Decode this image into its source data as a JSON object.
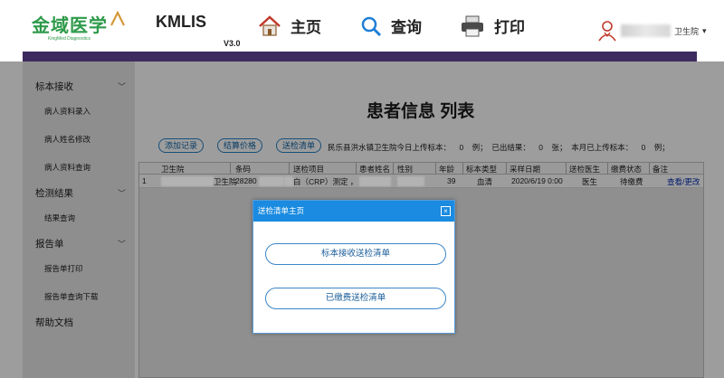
{
  "header": {
    "logo_cn": "金域医学",
    "logo_en": "KingMed Diagnostics",
    "app_name": "KMLIS",
    "version": "V3.0",
    "nav": [
      {
        "label": "主页",
        "icon": "home-icon"
      },
      {
        "label": "查询",
        "icon": "search-icon"
      },
      {
        "label": "打印",
        "icon": "printer-icon"
      }
    ],
    "user_suffix": "卫生院",
    "user_caret": "▾"
  },
  "colors": {
    "brand_green": "#2e9a4a",
    "header_bar": "#3d2a5e",
    "modal_title_bg": "#1a8be0",
    "modal_button_border": "#3b86c8"
  },
  "sidebar": {
    "groups": [
      {
        "label": "标本接收",
        "items": [
          "病人资料录入",
          "病人姓名修改",
          "病人资料查询"
        ]
      },
      {
        "label": "检测结果",
        "items": [
          "结果查询"
        ]
      },
      {
        "label": "报告单",
        "items": [
          "报告单打印",
          "报告单查询下载"
        ]
      },
      {
        "label": "帮助文档",
        "items": []
      }
    ]
  },
  "main": {
    "title": "患者信息 列表",
    "toolbar": [
      "添加记录",
      "结算价格",
      "送检清单"
    ],
    "stats": "民乐县洪水镇卫生院今日上传标本：    0    例；  已出结果：    0    张；  本月已上传标本：    0    例；"
  },
  "grid": {
    "columns": [
      "卫生院",
      "条码",
      "送检项目",
      "患者姓名",
      "性别",
      "年龄",
      "标本类型",
      "采样日期",
      "送检医生",
      "缴费状态",
      "备注"
    ],
    "rows": [
      {
        "index": "1",
        "hospital": "卫生院",
        "barcode": "28280",
        "item": "白（CRP）测定 ，",
        "name": "",
        "gender": "",
        "age": "39",
        "sample": "血清",
        "date": "2020/6/19 0:00",
        "doctor": "医生",
        "pay": "待缴费",
        "action": "查看/更改"
      }
    ]
  },
  "modal": {
    "title": "送检清单主页",
    "close": "×",
    "buttons": [
      "标本接收送检清单",
      "已缴费送检清单"
    ]
  }
}
